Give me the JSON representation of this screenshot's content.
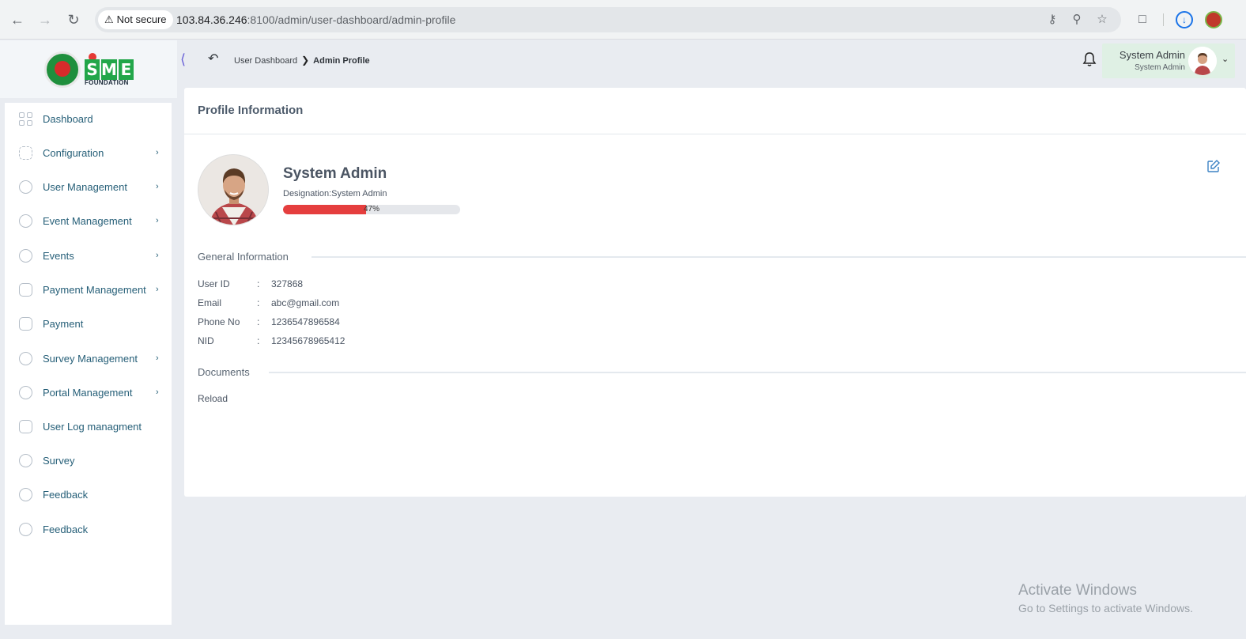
{
  "browser": {
    "security_label": "Not secure",
    "url_host": "103.84.36.246",
    "url_rest": ":8100/admin/user-dashboard/admin-profile"
  },
  "logo": {
    "letters": [
      "S",
      "M",
      "E"
    ],
    "subtitle": "FOUNDATION"
  },
  "sidebar": {
    "items": [
      {
        "label": "Dashboard",
        "icon": "grid-icon",
        "has_submenu": false
      },
      {
        "label": "Configuration",
        "icon": "config-icon",
        "has_submenu": true
      },
      {
        "label": "User Management",
        "icon": "shield-icon",
        "has_submenu": true
      },
      {
        "label": "Event Management",
        "icon": "lock-icon",
        "has_submenu": true
      },
      {
        "label": "Events",
        "icon": "lock-icon",
        "has_submenu": true
      },
      {
        "label": "Payment Management",
        "icon": "payment-icon",
        "has_submenu": true
      },
      {
        "label": "Payment",
        "icon": "payment-icon",
        "has_submenu": false
      },
      {
        "label": "Survey Management",
        "icon": "pie-icon",
        "has_submenu": true
      },
      {
        "label": "Portal Management",
        "icon": "lock-icon",
        "has_submenu": true
      },
      {
        "label": "User Log managment",
        "icon": "payment-icon",
        "has_submenu": false
      },
      {
        "label": "Survey",
        "icon": "pie-icon",
        "has_submenu": false
      },
      {
        "label": "Feedback",
        "icon": "feedback-icon",
        "has_submenu": false
      },
      {
        "label": "Feedback",
        "icon": "feedback-icon",
        "has_submenu": false
      }
    ]
  },
  "header": {
    "breadcrumb": {
      "parent": "User Dashboard",
      "current": "Admin Profile"
    },
    "user": {
      "name": "System Admin",
      "role": "System Admin"
    }
  },
  "profile": {
    "card_title": "Profile Information",
    "name": "System Admin",
    "designation": "Designation:System Admin",
    "completion_percent": 47,
    "completion_label": "47%",
    "general_title": "General Information",
    "fields": [
      {
        "key": "User ID",
        "value": "327868"
      },
      {
        "key": "Email",
        "value": "abc@gmail.com"
      },
      {
        "key": "Phone No",
        "value": "1236547896584"
      },
      {
        "key": "NID",
        "value": "12345678965412"
      }
    ],
    "documents_title": "Documents",
    "document_alt": "Reload"
  },
  "watermark": {
    "line1": "Activate Windows",
    "line2": "Go to Settings to activate Windows."
  },
  "colors": {
    "accent_green": "#22a64a",
    "progress_red": "#e53e3e",
    "sidebar_text": "#265f78",
    "user_chip_bg": "#dff0e4"
  }
}
